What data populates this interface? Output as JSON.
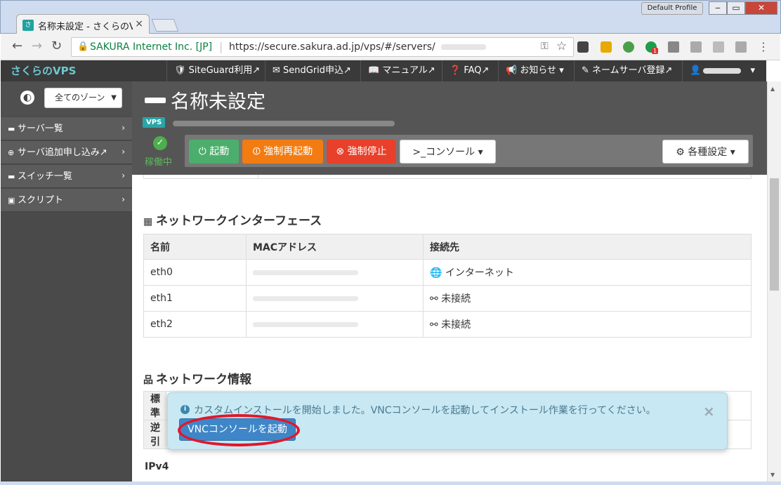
{
  "browser": {
    "tab_title": "名称未設定 - さくらのVPS",
    "tab_favicon": "さ",
    "tab_close": "×",
    "profile_label": "Default Profile",
    "window_minimize": "‒",
    "window_maximize": "▭",
    "window_close": "✕",
    "back": "←",
    "forward": "→",
    "reload": "↻",
    "lock": "🔒",
    "site_name": "SAKURA Internet Inc. [JP]",
    "url_sep": "|",
    "url": "https://secure.sakura.ad.jp/vps/#/servers/",
    "key": "⚿",
    "star": "☆",
    "ext_badge": "1",
    "menu": "⋮",
    "extensions": [
      "pocket-icon",
      "extension-icon",
      "evernote-icon",
      "green-extension-icon",
      "s-extension-icon",
      "drive-icon",
      "dropbox-icon",
      "pdf-icon"
    ]
  },
  "nav": {
    "logo": "さくらのVPS",
    "items": [
      "🛡 SiteGuard利用↗",
      "✉ SendGrid申込↗",
      "📖 マニュアル↗",
      "❓ FAQ↗",
      "📢 お知らせ ▾",
      "✎ ネームサーバ登録↗"
    ],
    "user": "👤",
    "user_caret": "▾"
  },
  "sidebar": {
    "globe": "◐",
    "zone": "全てのゾーン",
    "zone_caret": "▼",
    "items": [
      {
        "icon": "▬",
        "label": "サーバ一覧",
        "chev": "›"
      },
      {
        "icon": "⊕",
        "label": "サーバ追加申し込み↗",
        "chev": "›"
      },
      {
        "icon": "▬",
        "label": "スイッチ一覧",
        "chev": "›"
      },
      {
        "icon": "▣",
        "label": "スクリプト",
        "chev": "›"
      }
    ]
  },
  "server": {
    "title": "名称未設定",
    "badge": "VPS",
    "status_icon": "✓",
    "status": "稼働中",
    "buttons": {
      "start": "⏻ 起動",
      "reboot": "⏼ 強制再起動",
      "stop": "⊗ 強制停止",
      "console": ">_コンソール ▾",
      "settings": "⚙ 各種設定 ▾"
    }
  },
  "network_interfaces": {
    "icon": "▦",
    "title": "ネットワークインターフェース",
    "columns": [
      "名前",
      "MACアドレス",
      "接続先"
    ],
    "rows": [
      {
        "name": "eth0",
        "connection": "🌐 インターネット"
      },
      {
        "name": "eth1",
        "connection": "⚯ 未接続"
      },
      {
        "name": "eth2",
        "connection": "⚯ 未接続"
      }
    ]
  },
  "network_info": {
    "icon": "品",
    "title": "ネットワーク情報",
    "rows": [
      "標準",
      "逆引"
    ],
    "ipv4_label": "IPv4"
  },
  "toast": {
    "icon": "i",
    "message": "カスタムインストールを開始しました。VNCコンソールを起動してインストール作業を行ってください。",
    "close": "×",
    "button": "VNCコンソールを起動"
  },
  "scrollbar": {
    "up": "▲",
    "down": "▼"
  },
  "colors": {
    "nav_bg": "#3a3a3a",
    "sidebar_bg": "#4a4a4a",
    "start": "#4cae6c",
    "reboot": "#f27c12",
    "stop": "#e8402a",
    "vnc": "#3e86c8",
    "highlight": "#e3162a"
  }
}
